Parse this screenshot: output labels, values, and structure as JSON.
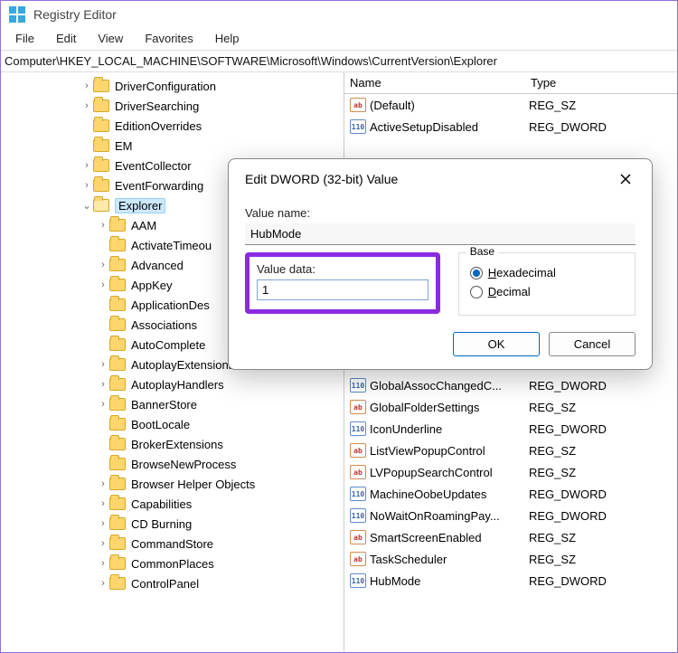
{
  "window": {
    "title": "Registry Editor"
  },
  "menu": [
    "File",
    "Edit",
    "View",
    "Favorites",
    "Help"
  ],
  "address": "Computer\\HKEY_LOCAL_MACHINE\\SOFTWARE\\Microsoft\\Windows\\CurrentVersion\\Explorer",
  "tree": {
    "top": [
      {
        "label": "DriverConfiguration",
        "exp": ">"
      },
      {
        "label": "DriverSearching",
        "exp": ">"
      },
      {
        "label": "EditionOverrides",
        "exp": ""
      },
      {
        "label": "EM",
        "exp": ""
      },
      {
        "label": "EventCollector",
        "exp": ">"
      },
      {
        "label": "EventForwarding",
        "exp": ">"
      }
    ],
    "selected": {
      "label": "Explorer",
      "exp": "v"
    },
    "children": [
      {
        "label": "AAM",
        "exp": ">"
      },
      {
        "label": "ActivateTimeou",
        "exp": ""
      },
      {
        "label": "Advanced",
        "exp": ">"
      },
      {
        "label": "AppKey",
        "exp": ">"
      },
      {
        "label": "ApplicationDes",
        "exp": ""
      },
      {
        "label": "Associations",
        "exp": ""
      },
      {
        "label": "AutoComplete",
        "exp": ""
      },
      {
        "label": "AutoplayExtensions",
        "exp": ">"
      },
      {
        "label": "AutoplayHandlers",
        "exp": ">"
      },
      {
        "label": "BannerStore",
        "exp": ">"
      },
      {
        "label": "BootLocale",
        "exp": ""
      },
      {
        "label": "BrokerExtensions",
        "exp": ""
      },
      {
        "label": "BrowseNewProcess",
        "exp": ""
      },
      {
        "label": "Browser Helper Objects",
        "exp": ">"
      },
      {
        "label": "Capabilities",
        "exp": ">"
      },
      {
        "label": "CD Burning",
        "exp": ">"
      },
      {
        "label": "CommandStore",
        "exp": ">"
      },
      {
        "label": "CommonPlaces",
        "exp": ">"
      },
      {
        "label": "ControlPanel",
        "exp": ">"
      }
    ]
  },
  "list": {
    "cols": {
      "name": "Name",
      "type": "Type"
    },
    "top": [
      {
        "name": "(Default)",
        "type": "REG_SZ",
        "kind": "sz"
      },
      {
        "name": "ActiveSetupDisabled",
        "type": "REG_DWORD",
        "kind": "dw"
      }
    ],
    "bottom": [
      {
        "name": "GlobalAssocChangedC...",
        "type": "REG_DWORD",
        "kind": "dw"
      },
      {
        "name": "GlobalFolderSettings",
        "type": "REG_SZ",
        "kind": "sz"
      },
      {
        "name": "IconUnderline",
        "type": "REG_DWORD",
        "kind": "dw"
      },
      {
        "name": "ListViewPopupControl",
        "type": "REG_SZ",
        "kind": "sz"
      },
      {
        "name": "LVPopupSearchControl",
        "type": "REG_SZ",
        "kind": "sz"
      },
      {
        "name": "MachineOobeUpdates",
        "type": "REG_DWORD",
        "kind": "dw"
      },
      {
        "name": "NoWaitOnRoamingPay...",
        "type": "REG_DWORD",
        "kind": "dw"
      },
      {
        "name": "SmartScreenEnabled",
        "type": "REG_SZ",
        "kind": "sz"
      },
      {
        "name": "TaskScheduler",
        "type": "REG_SZ",
        "kind": "sz"
      },
      {
        "name": "HubMode",
        "type": "REG_DWORD",
        "kind": "dw"
      }
    ]
  },
  "dialog": {
    "title": "Edit DWORD (32-bit) Value",
    "value_name_label": "Value name:",
    "value_name": "HubMode",
    "value_data_label": "Value data:",
    "value_data": "1",
    "base_label": "Base",
    "hex_label": "Hexadecimal",
    "dec_label": "Decimal",
    "ok": "OK",
    "cancel": "Cancel"
  }
}
